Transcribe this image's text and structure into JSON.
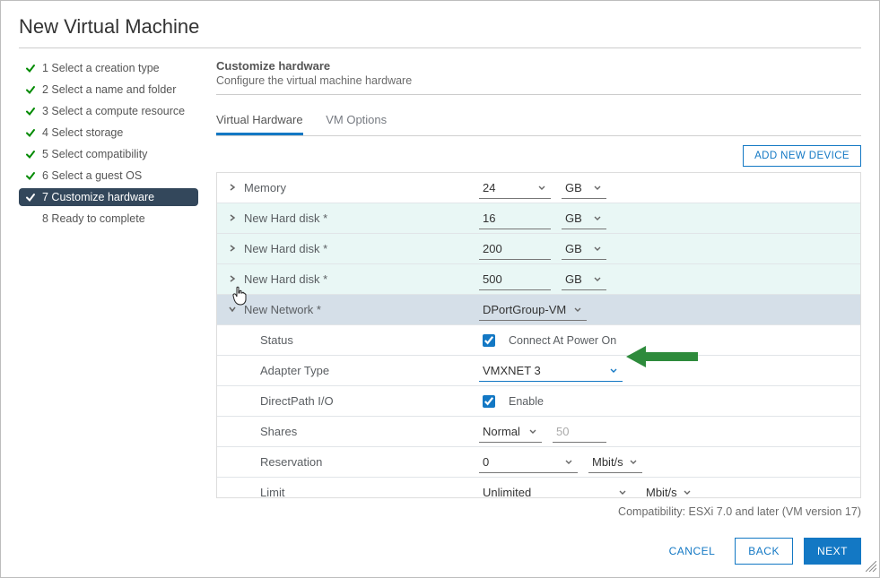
{
  "title": "New Virtual Machine",
  "sidebar": {
    "steps": [
      {
        "label": "1 Select a creation type",
        "done": true
      },
      {
        "label": "2 Select a name and folder",
        "done": true
      },
      {
        "label": "3 Select a compute resource",
        "done": true
      },
      {
        "label": "4 Select storage",
        "done": true
      },
      {
        "label": "5 Select compatibility",
        "done": true
      },
      {
        "label": "6 Select a guest OS",
        "done": true
      },
      {
        "label": "7 Customize hardware",
        "done": true,
        "selected": true
      },
      {
        "label": "8 Ready to complete",
        "done": false
      }
    ]
  },
  "panel": {
    "heading": "Customize hardware",
    "sub": "Configure the virtual machine hardware",
    "tabs": {
      "hw": "Virtual Hardware",
      "opts": "VM Options"
    },
    "addDevice": "ADD NEW DEVICE"
  },
  "hw": {
    "memory": {
      "label": "Memory",
      "value": "24",
      "unit": "GB"
    },
    "disks": [
      {
        "label": "New Hard disk *",
        "value": "16",
        "unit": "GB"
      },
      {
        "label": "New Hard disk *",
        "value": "200",
        "unit": "GB"
      },
      {
        "label": "New Hard disk *",
        "value": "500",
        "unit": "GB"
      }
    ],
    "network": {
      "label": "New Network *",
      "value": "DPortGroup-VM",
      "status": {
        "label": "Status",
        "text": "Connect At Power On",
        "checked": true
      },
      "adapter": {
        "label": "Adapter Type",
        "value": "VMXNET 3"
      },
      "directpath": {
        "label": "DirectPath I/O",
        "text": "Enable",
        "checked": true
      },
      "shares": {
        "label": "Shares",
        "value": "Normal",
        "level": "50"
      },
      "reservation": {
        "label": "Reservation",
        "value": "0",
        "unit": "Mbit/s"
      },
      "limit": {
        "label": "Limit",
        "value": "Unlimited",
        "unit": "Mbit/s"
      }
    }
  },
  "compat": "Compatibility: ESXi 7.0 and later (VM version 17)",
  "footer": {
    "cancel": "CANCEL",
    "back": "BACK",
    "next": "NEXT"
  }
}
